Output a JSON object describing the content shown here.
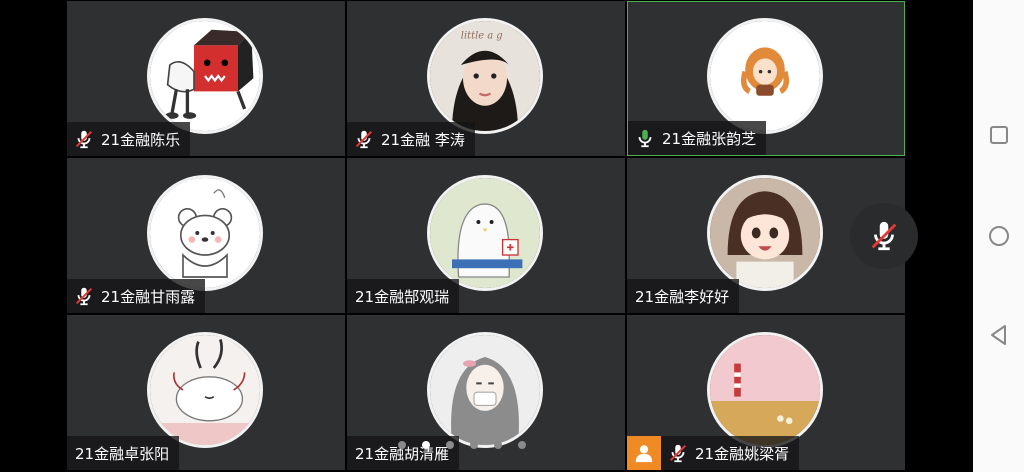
{
  "participants": [
    {
      "name": "21金融陈乐",
      "muted": true,
      "active": false
    },
    {
      "name": "21金融 李涛",
      "muted": true,
      "active": false
    },
    {
      "name": "21金融张韵芝",
      "muted": false,
      "active": true
    },
    {
      "name": "21金融甘雨露",
      "muted": true,
      "active": false
    },
    {
      "name": "21金融郜观瑞",
      "muted": null,
      "active": false
    },
    {
      "name": "21金融李好好",
      "muted": null,
      "active": false
    },
    {
      "name": "21金融卓张阳",
      "muted": null,
      "active": false
    },
    {
      "name": "21金融胡清雁",
      "muted": null,
      "active": false
    },
    {
      "name": "21金融姚梁胥",
      "muted": true,
      "active": false
    }
  ],
  "avatar_texts": {
    "p2_overlay": "little a g"
  },
  "pager": {
    "pages": 6,
    "current": 2
  },
  "colors": {
    "tile_bg": "#2f3032",
    "active_border": "#4caf50",
    "mic_green": "#4caf50",
    "mic_muted_slash": "#e53935",
    "user_badge": "#f08a24"
  },
  "icons": {
    "muted_mic": "mic-muted-icon",
    "active_mic": "mic-active-icon",
    "user_badge": "user-icon",
    "floating_mic": "mic-muted-icon",
    "nav_recent": "square-icon",
    "nav_home": "circle-icon",
    "nav_back": "triangle-back-icon"
  }
}
